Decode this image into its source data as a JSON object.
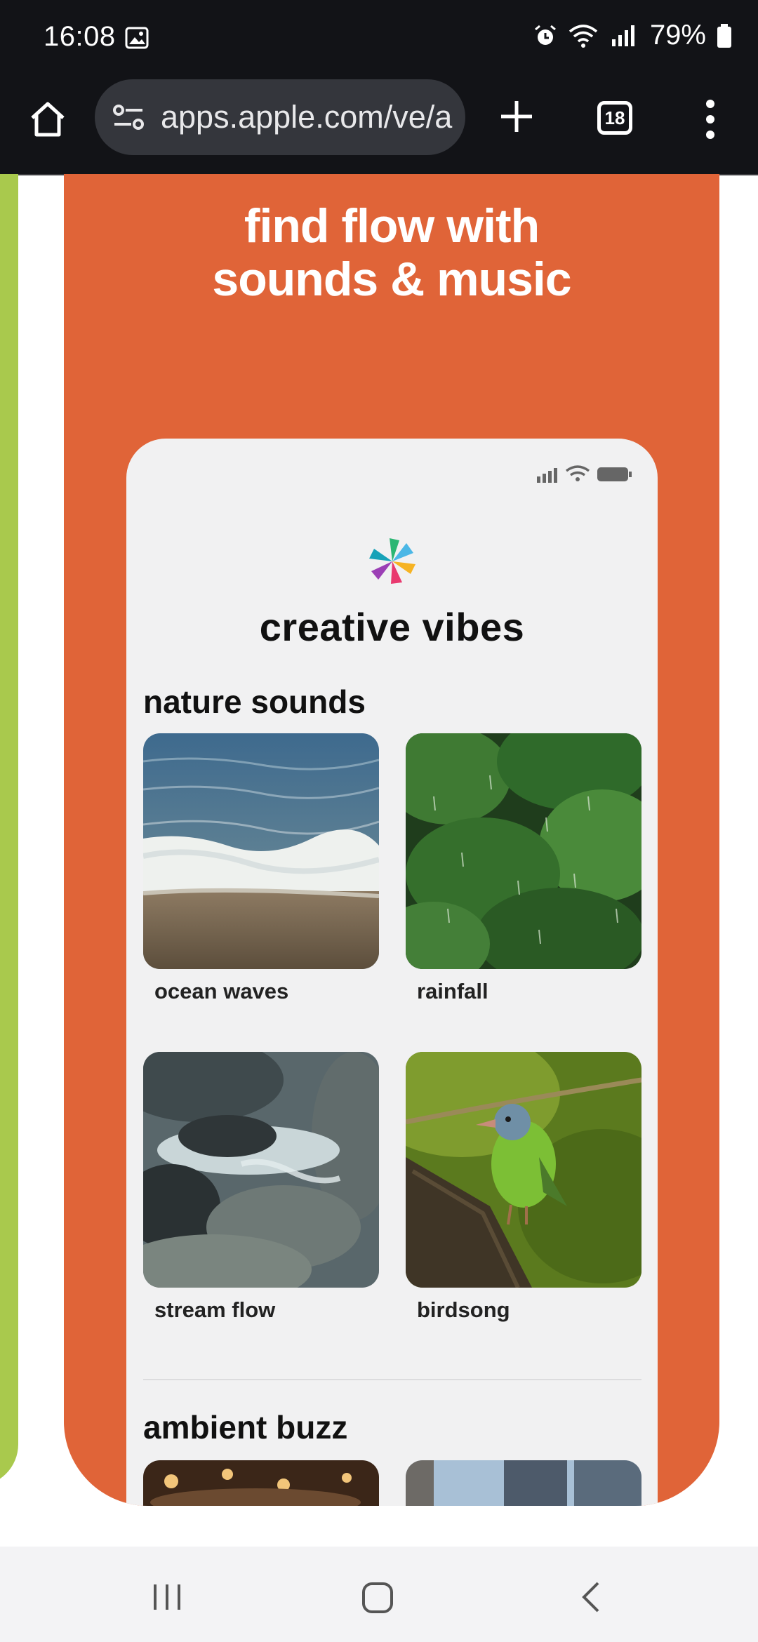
{
  "status_bar": {
    "time": "16:08",
    "battery": "79%",
    "icons": [
      "gallery-icon",
      "alarm-icon",
      "wifi-icon",
      "signal-icon",
      "battery-icon"
    ]
  },
  "browser": {
    "url": "apps.apple.com/ve/a",
    "tab_count": "18",
    "icons": [
      "home-icon",
      "site-settings-icon",
      "new-tab-icon",
      "tabs-icon",
      "menu-icon"
    ]
  },
  "promo": {
    "headline_line1": "find flow with",
    "headline_line2": "sounds & music",
    "background_color": "#e06438",
    "neighbor_card_color": "#a9c94d"
  },
  "app_preview": {
    "title": "creative vibes",
    "sections": [
      {
        "title": "nature sounds",
        "items": [
          {
            "label": "ocean waves"
          },
          {
            "label": "rainfall"
          },
          {
            "label": "stream flow"
          },
          {
            "label": "birdsong"
          }
        ]
      },
      {
        "title": "ambient buzz",
        "items": []
      }
    ]
  },
  "system_nav": {
    "icons": [
      "recent-apps-icon",
      "home-button-icon",
      "back-icon"
    ]
  }
}
